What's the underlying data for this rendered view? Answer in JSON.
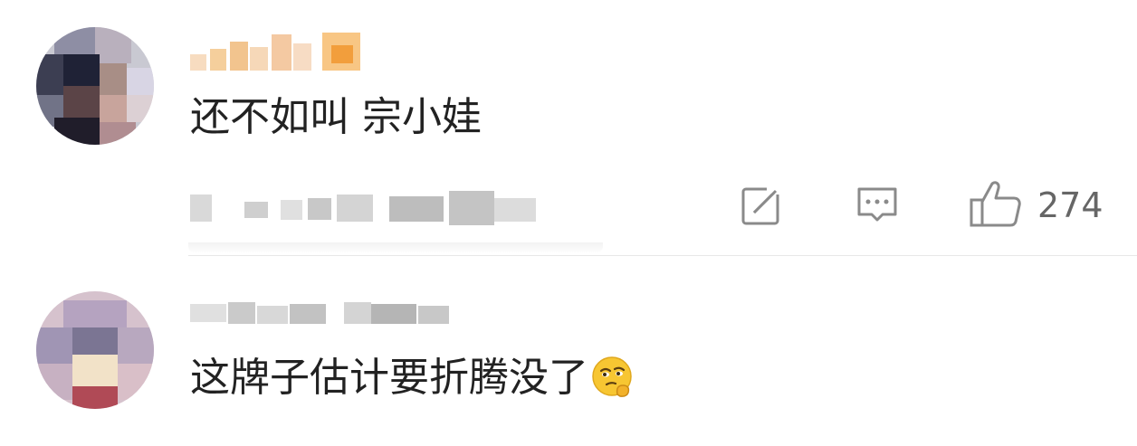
{
  "comments": [
    {
      "username": "",
      "text": "还不如叫 宗小娃",
      "like_count": "274",
      "icons": {
        "share": "share-icon",
        "reply": "comment-icon",
        "like": "thumbs-up-icon"
      }
    },
    {
      "username": "",
      "text": "这牌子估计要折腾没了",
      "emoji": "thinking-face-emoji"
    }
  ]
}
